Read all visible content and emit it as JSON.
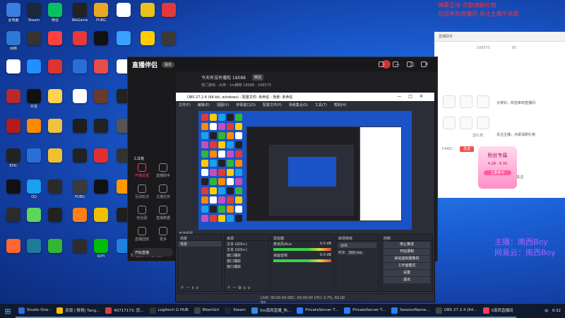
{
  "desktop_icons": [
    {
      "label": "此电脑",
      "color": "#3b7de0"
    },
    {
      "label": "Steam",
      "color": "#1b2838"
    },
    {
      "label": "微信",
      "color": "#07c160"
    },
    {
      "label": "WeGame",
      "color": "#222"
    },
    {
      "label": "PUBG",
      "color": "#e8a825"
    },
    {
      "label": "",
      "color": "#ffffff"
    },
    {
      "label": "",
      "color": "#e8c21a"
    },
    {
      "label": "",
      "color": "#e03a3a"
    },
    {
      "label": "网络",
      "color": "#2c7ad6"
    },
    {
      "label": "",
      "color": "#333"
    },
    {
      "label": "",
      "color": "#ff4040"
    },
    {
      "label": "",
      "color": "#e63a3a"
    },
    {
      "label": "",
      "color": "#111"
    },
    {
      "label": "",
      "color": "#3aa0ff"
    },
    {
      "label": "",
      "color": "#ffcc00"
    },
    {
      "label": "",
      "color": "#3a3a3a"
    },
    {
      "label": "",
      "color": "#ffffff"
    },
    {
      "label": "",
      "color": "#1e90ff"
    },
    {
      "label": "",
      "color": "#d33"
    },
    {
      "label": "",
      "color": "#2a6fd6"
    },
    {
      "label": "",
      "color": "#e64d4d"
    },
    {
      "label": "",
      "color": "#ffffff"
    },
    {
      "label": "",
      "color": "#2d6be0"
    },
    {
      "label": "",
      "color": "#ffffff"
    },
    {
      "label": "",
      "color": "#b62a2a"
    },
    {
      "label": "抖音",
      "color": "#111"
    },
    {
      "label": "",
      "color": "#ffd34d"
    },
    {
      "label": "",
      "color": "#ffffff"
    },
    {
      "label": "",
      "color": "#6a3a2a"
    },
    {
      "label": "",
      "color": "#222"
    },
    {
      "label": "",
      "color": "#b31a1a"
    },
    {
      "label": "",
      "color": "#ff8a00"
    },
    {
      "label": "",
      "color": "#f0c040"
    },
    {
      "label": "",
      "color": "#1e1e1e"
    },
    {
      "label": "",
      "color": "#222"
    },
    {
      "label": "",
      "color": "#555"
    },
    {
      "label": "EPIC",
      "color": "#222"
    },
    {
      "label": "",
      "color": "#2a6fd6"
    },
    {
      "label": "",
      "color": "#f0c030"
    },
    {
      "label": "",
      "color": "#222"
    },
    {
      "label": "",
      "color": "#e23030"
    },
    {
      "label": "",
      "color": "#333"
    },
    {
      "label": "",
      "color": "#111"
    },
    {
      "label": "QQ",
      "color": "#1aa0f0"
    },
    {
      "label": "",
      "color": "#2a2a2a"
    },
    {
      "label": "PUBG",
      "color": "#3a3a3a"
    },
    {
      "label": "",
      "color": "#111"
    },
    {
      "label": "",
      "color": "#ff9900"
    },
    {
      "label": "",
      "color": "#2b2b2b"
    },
    {
      "label": "",
      "color": "#5cd65c"
    },
    {
      "label": "",
      "color": "#222"
    },
    {
      "label": "",
      "color": "#ff7f1a"
    },
    {
      "label": "",
      "color": "#f0c000"
    },
    {
      "label": "",
      "color": "#1e1e1e"
    },
    {
      "label": "",
      "color": "#ff6633"
    },
    {
      "label": "",
      "color": "#1f7a9a"
    },
    {
      "label": "",
      "color": "#35b535"
    },
    {
      "label": "",
      "color": "#2d2d2d"
    },
    {
      "label": "iQIYI",
      "color": "#00be06"
    },
    {
      "label": "",
      "color": "#2080e0"
    },
    {
      "label": "",
      "color": "#e03030"
    },
    {
      "label": "",
      "color": "#ffcc33"
    },
    {
      "label": "",
      "color": "#d02050"
    },
    {
      "label": "",
      "color": "#444"
    },
    {
      "label": "",
      "color": "#ff9020"
    },
    {
      "label": "",
      "color": "#ffffff"
    },
    {
      "label": "",
      "color": "#c050c0"
    },
    {
      "label": "",
      "color": "#4a88ff"
    }
  ],
  "overlay": {
    "line1": "弹幕互动 点歌请刷礼物",
    "line2": "欢迎来到直播间 关注主播不迷路",
    "nick1": "主播：南西Boy",
    "nick2": "网易云：南西Boy"
  },
  "browser": {
    "tab": "直播助手",
    "stat1": "106575",
    "stat2": "65",
    "chat1": "大家好，欢迎来到直播间",
    "chat2": "关注主播，点歌请刷礼物",
    "chat3": "直播中 点赞 关注",
    "input_value": "14482",
    "send_label": "发送",
    "badge_title": "粉丝专属",
    "badge_date": "4.28 - 8.30",
    "badge_sub": "立即参与",
    "gift_label": "送礼物"
  },
  "live_app": {
    "brand": "直播伴侣",
    "version_pill": "版本",
    "room_title": "今天有没有播啦 18088",
    "room_tag": "精选",
    "stats": "热门游戏 · 大神 · 1m推荐 18088 · 106575",
    "nav": [
      {
        "label": "开播设置",
        "color": "#ff3b5c"
      },
      {
        "label": "直播助手",
        "color": "#888"
      },
      {
        "label": "互动玩法",
        "color": "#888"
      },
      {
        "label": "主播任务",
        "color": "#888"
      },
      {
        "label": "粉丝团",
        "color": "#888"
      },
      {
        "label": "直播数据",
        "color": "#888"
      },
      {
        "label": "直播回放",
        "color": "#888"
      },
      {
        "label": "更多",
        "color": "#888"
      }
    ],
    "tools_heading": "工具箱",
    "status": "5.6直播间中途场控开",
    "start_label": "开始直播"
  },
  "obs": {
    "title": "OBS 27.2.4 (64-bit, windows) - 配置文件: 未命名 - 场景: 未命名",
    "menu": [
      "文件(F)",
      "编辑(E)",
      "视图(V)",
      "停靠窗口(D)",
      "配置文件(P)",
      "场景集合(S)",
      "工具(T)",
      "帮助(H)"
    ],
    "scene_bar": "未选择源",
    "docks": {
      "scenes": {
        "title": "场景",
        "items": [
          "场景"
        ]
      },
      "sources": {
        "title": "来源",
        "items": [
          "文本 (GDI+)",
          "文本 (GDI+)",
          "窗口捕获",
          "窗口捕获",
          "窗口捕获"
        ]
      },
      "mixer": {
        "title": "混音器",
        "tracks": [
          {
            "name": "麦克风/Aux",
            "db": "0.0 dB"
          },
          {
            "name": "桌面音频",
            "db": "0.0 dB"
          }
        ]
      },
      "transitions": {
        "title": "转场特效",
        "type": "淡出",
        "duration_label": "时长",
        "duration": "300 ms"
      },
      "controls": {
        "title": "控制",
        "buttons": [
          "停止推流",
          "开始录制",
          "启动虚拟摄像机",
          "工作室模式",
          "设置",
          "退出"
        ]
      }
    },
    "status_bar": "LIVE: 00:00:00   REC: 00:00:00   CPU: 3.7%, 60.00 fps"
  },
  "taskbar": {
    "items": [
      {
        "label": "Studio One -",
        "color": "#2d6be0"
      },
      {
        "label": "资源 | 猴哥| Tang...",
        "color": "#f5c000"
      },
      {
        "label": "40717173: 您...",
        "color": "#d94040"
      },
      {
        "label": "Logitech G HUB",
        "color": "#333"
      },
      {
        "label": "BikerGirl",
        "color": "#444"
      },
      {
        "label": "Steam",
        "color": "#1b2838"
      },
      {
        "label": "5m南西直播_热...",
        "color": "#3a8ae0"
      },
      {
        "label": "PrivateServer T...",
        "color": "#2a7fff"
      },
      {
        "label": "PrivateServer T...",
        "color": "#2a7fff"
      },
      {
        "label": "SessionName...",
        "color": "#2a7fff"
      },
      {
        "label": "OBS 27.2.4 (64...",
        "color": "#444"
      },
      {
        "label": "5南西直播间",
        "color": "#ff3b5c"
      }
    ],
    "time": "9:32",
    "lang": "中"
  }
}
